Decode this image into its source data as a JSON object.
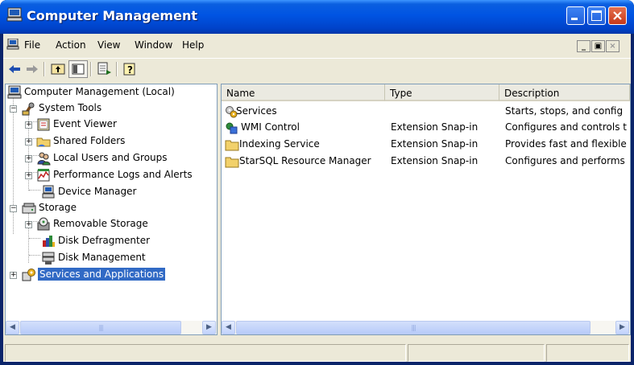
{
  "window": {
    "title": "Computer Management"
  },
  "menubar": {
    "items": [
      "File",
      "Action",
      "View",
      "Window",
      "Help"
    ]
  },
  "toolbar": {
    "buttons": [
      "back-icon",
      "forward-icon",
      "up-one-level-icon",
      "show-hide-tree-icon",
      "export-list-icon",
      "help-icon"
    ]
  },
  "tree": {
    "root": "Computer Management (Local)",
    "system_tools": "System Tools",
    "event_viewer": "Event Viewer",
    "shared_folders": "Shared Folders",
    "local_users": "Local Users and Groups",
    "perf_logs": "Performance Logs and Alerts",
    "device_manager": "Device Manager",
    "storage": "Storage",
    "removable_storage": "Removable Storage",
    "disk_defrag": "Disk Defragmenter",
    "disk_mgmt": "Disk Management",
    "services_apps": "Services and Applications"
  },
  "list": {
    "headers": [
      "Name",
      "Type",
      "Description"
    ],
    "rows": [
      {
        "name": "Services",
        "type": "",
        "description": "Starts, stops, and config"
      },
      {
        "name": "WMI Control",
        "type": "Extension Snap-in",
        "description": "Configures and controls t"
      },
      {
        "name": "Indexing Service",
        "type": "Extension Snap-in",
        "description": "Provides fast and flexible"
      },
      {
        "name": "StarSQL Resource Manager",
        "type": "Extension Snap-in",
        "description": "Configures and performs"
      }
    ]
  },
  "colors": {
    "titlebar": "#0054E3",
    "selection": "#316AC5",
    "face": "#ECE9D8"
  }
}
